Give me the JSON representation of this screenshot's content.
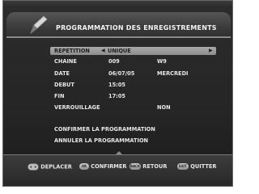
{
  "header": {
    "title": "PROGRAMMATION DES ENREGISTREMENTS",
    "icon": "pen-icon"
  },
  "form": {
    "repetition": {
      "label": "REPETITION",
      "value": "UNIQUE"
    },
    "chaine": {
      "label": "CHAINE",
      "number": "009",
      "name": "W9"
    },
    "date": {
      "label": "DATE",
      "value": "06/07/05",
      "day": "MERCREDI"
    },
    "debut": {
      "label": "DEBUT",
      "value": "15:05"
    },
    "fin": {
      "label": "FIN",
      "value": "17:05"
    },
    "verrouillage": {
      "label": "VERROUILLAGE",
      "value": "NON"
    }
  },
  "actions": {
    "confirm": "CONFIRMER LA PROGRAMMATION",
    "cancel": "ANNULER LA PROGRAMMATION"
  },
  "footer": {
    "move": "DEPLACER",
    "ok_key": "OK",
    "confirm": "CONFIRMER",
    "back_key": "BACK",
    "back": "RETOUR",
    "exit_key": "EXIT",
    "quit": "QUITTER"
  },
  "colors": {
    "background": "#252525",
    "highlight": "#a0a0a0",
    "text": "#e6e6e6"
  }
}
